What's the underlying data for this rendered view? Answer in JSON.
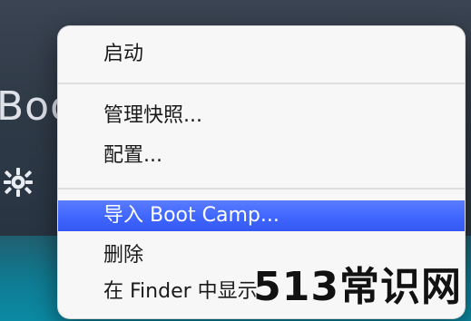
{
  "background": {
    "partial_title": "Boo"
  },
  "context_menu": {
    "items": [
      {
        "label": "启动"
      },
      {
        "label": "管理快照..."
      },
      {
        "label": "配置..."
      },
      {
        "label": "导入 Boot Camp..."
      },
      {
        "label": "删除"
      },
      {
        "label": "在 Finder 中显示"
      }
    ],
    "highlighted_index": 3
  },
  "watermark": {
    "text": "513常识网"
  },
  "colors": {
    "menu_bg": "#f7f7f7",
    "highlight": "#3f66ff"
  },
  "icons": {
    "background_gear": "gear-icon"
  }
}
